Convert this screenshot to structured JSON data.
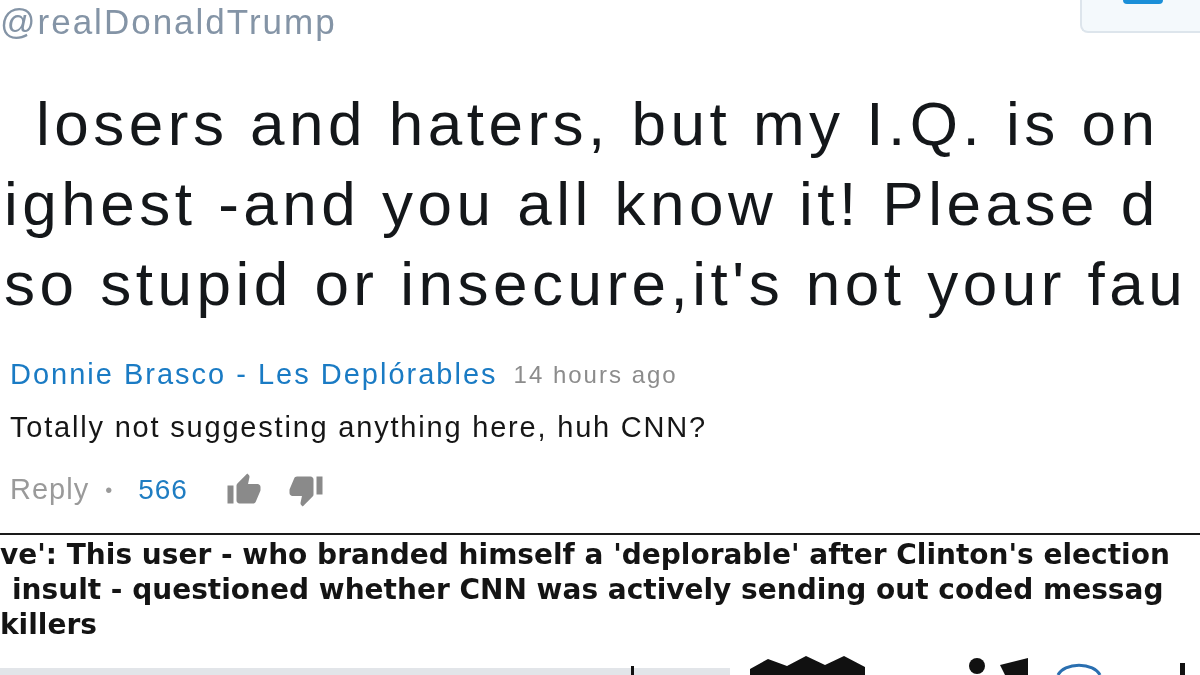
{
  "tweet": {
    "handle": "@realDonaldTrump",
    "lines": [
      "losers and haters, but my I.Q. is on",
      "ighest -and you all know it! Please d",
      "so stupid or insecure,it's not your fau"
    ]
  },
  "comment": {
    "author": "Donnie Brasco - Les Deplórables",
    "time": "14 hours ago",
    "text": "Totally not suggesting anything here, huh CNN?",
    "reply_label": "Reply",
    "separator": "•",
    "likes": "566"
  },
  "caption": {
    "lines": [
      "ve': This user - who branded himself a 'deplorable' after Clinton's election",
      "insult - questioned whether CNN was actively sending out coded messag",
      "killers"
    ]
  }
}
